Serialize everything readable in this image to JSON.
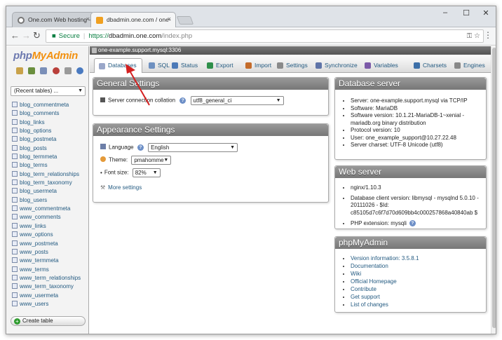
{
  "browser": {
    "tabs": [
      {
        "title": "One.com Web hosting –",
        "active": false
      },
      {
        "title": "dbadmin.one.com / one-",
        "active": true
      }
    ],
    "address": {
      "secure_label": "Secure",
      "scheme": "https://",
      "host": "dbadmin.one.com",
      "path": "/index.php"
    }
  },
  "sidebar": {
    "logo_php": "php",
    "logo_myadmin": "MyAdmin",
    "recent_label": "(Recent tables) ...",
    "tables": [
      "blog_commentmeta",
      "blog_comments",
      "blog_links",
      "blog_options",
      "blog_postmeta",
      "blog_posts",
      "blog_termmeta",
      "blog_terms",
      "blog_term_relationships",
      "blog_term_taxonomy",
      "blog_usermeta",
      "blog_users",
      "www_commentmeta",
      "www_comments",
      "www_links",
      "www_options",
      "www_postmeta",
      "www_posts",
      "www_termmeta",
      "www_terms",
      "www_term_relationships",
      "www_term_taxonomy",
      "www_usermeta",
      "www_users"
    ],
    "create_table": "Create table"
  },
  "server_bar": "one-example.support.mysql:3306",
  "nav_tabs": [
    {
      "label": "Databases",
      "color": "#9aa7c9"
    },
    {
      "label": "SQL",
      "color": "#6e90c0"
    },
    {
      "label": "Status",
      "color": "#4d7ab8"
    },
    {
      "label": "Export",
      "color": "#2f8f4a"
    },
    {
      "label": "Import",
      "color": "#c46b2a"
    },
    {
      "label": "Settings",
      "color": "#8a8a8a"
    },
    {
      "label": "Synchronize",
      "color": "#5f74a8"
    },
    {
      "label": "Variables",
      "color": "#7c5aa8"
    },
    {
      "label": "Charsets",
      "color": "#3c6fa8"
    },
    {
      "label": "Engines",
      "color": "#888888"
    }
  ],
  "general": {
    "title": "General Settings",
    "collation_label": "Server connection collation",
    "collation_value": "utf8_general_ci"
  },
  "appearance": {
    "title": "Appearance Settings",
    "language_label": "Language",
    "language_value": "English",
    "theme_label": "Theme:",
    "theme_value": "pmahomme",
    "fontsize_label": "Font size:",
    "fontsize_value": "82%",
    "more_settings": "More settings"
  },
  "db_server": {
    "title": "Database server",
    "items": [
      "Server: one-example.support.mysql via TCP/IP",
      "Software: MariaDB",
      "Software version: 10.1.21-MariaDB-1~xenial -",
      "mariadb.org binary distribution",
      "Protocol version: 10",
      "User: one_example_support@10.27.22.48",
      "Server charset: UTF-8 Unicode (utf8)"
    ]
  },
  "web_server": {
    "title": "Web server",
    "items": [
      "nginx/1.10.3",
      "Database client version: libmysql - mysqlnd 5.0.10 -",
      "20111026 - $Id:",
      "c85105d7c6f7d70d609bb4c000257868a40840ab $",
      "PHP extension: mysqli"
    ]
  },
  "pma": {
    "title": "phpMyAdmin",
    "items": [
      "Version information: 3.5.8.1",
      "Documentation",
      "Wiki",
      "Official Homepage",
      "Contribute",
      "Get support",
      "List of changes"
    ]
  },
  "colors": {
    "arrow": "#d42020",
    "link": "#235a81"
  }
}
